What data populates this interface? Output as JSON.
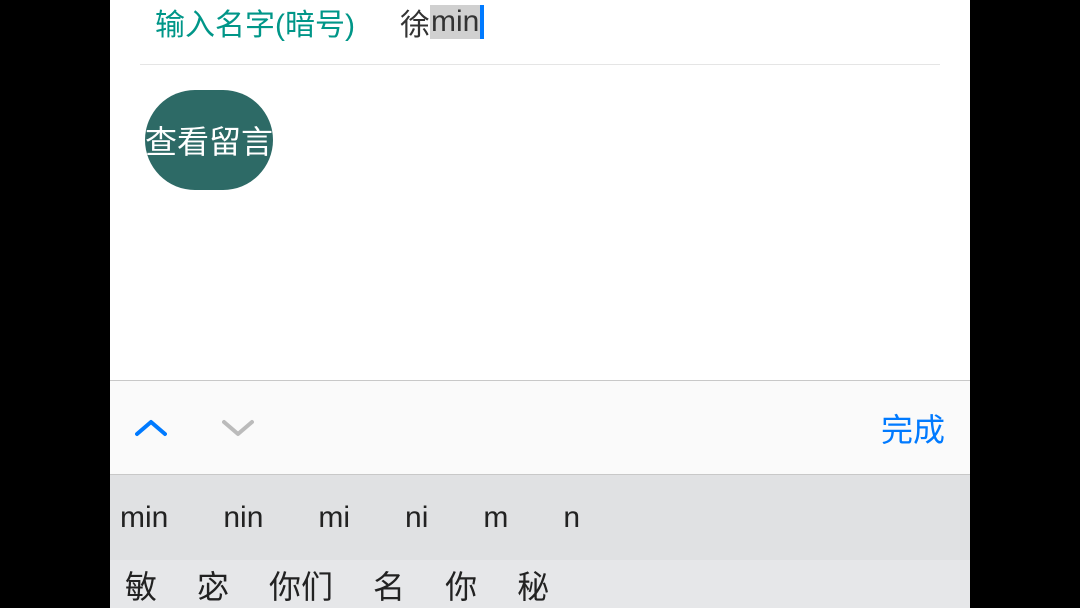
{
  "input": {
    "label": "输入名字(暗号)",
    "value_committed": "徐",
    "value_typing": "min"
  },
  "button": {
    "submit": "查看留言"
  },
  "keyboard": {
    "done": "完成",
    "suggestions": [
      "min",
      "nin",
      "mi",
      "ni",
      "m",
      "n"
    ],
    "candidates": [
      "敏",
      "宓",
      "你们",
      "名",
      "你",
      "秘"
    ]
  }
}
